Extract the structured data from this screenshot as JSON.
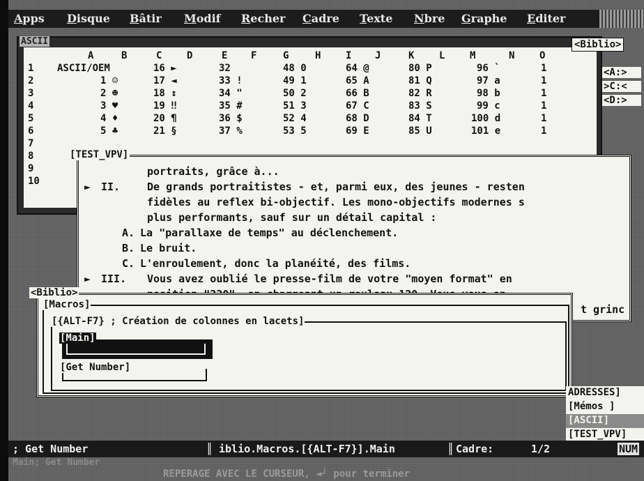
{
  "menu": [
    "Apps",
    "Disque",
    "Bâtir",
    "Modif",
    "Recher",
    "Cadre",
    "Texte",
    "Nbre",
    "Graphe",
    "Editer"
  ],
  "ascii_window": {
    "title": "ASCII",
    "columns": [
      "A",
      "B",
      "C",
      "D",
      "E",
      "F",
      "G",
      "H",
      "I",
      "J",
      "K",
      "L",
      "M",
      "N",
      "O"
    ],
    "rows": [
      "1",
      "2",
      "3",
      "4",
      "5",
      "6",
      "7",
      "8",
      "9",
      "10"
    ],
    "cells": [
      [
        "ASCII/OEM",
        "16 ►",
        "32",
        "48 0",
        "64 @",
        "80 P",
        "96 `",
        "1"
      ],
      [
        "1 ☺",
        "17 ◄",
        "33 !",
        "49 1",
        "65 A",
        "81 Q",
        "97 a",
        "1"
      ],
      [
        "2 ☻",
        "18 ↕",
        "34 \"",
        "50 2",
        "66 B",
        "82 R",
        "98 b",
        "1"
      ],
      [
        "3 ♥",
        "19 ‼",
        "35 #",
        "51 3",
        "67 C",
        "83 S",
        "99 c",
        "1"
      ],
      [
        "4 ♦",
        "20 ¶",
        "36 $",
        "52 4",
        "68 D",
        "84 T",
        "100 d",
        "1"
      ],
      [
        "5 ♣",
        "21 §",
        "37 %",
        "53 5",
        "69 E",
        "85 U",
        "101 e",
        "1"
      ]
    ]
  },
  "right_side": {
    "biblio_label": "<Biblio>",
    "drives": [
      "<A:>",
      ">C:<",
      "<D:>"
    ]
  },
  "doc_window": {
    "title": "[TEST_VPV]",
    "lines": [
      {
        "marker": "",
        "num": "",
        "text": "portraits, grâce à..."
      },
      {
        "marker": "►",
        "num": "II.",
        "text": "De grands portraitistes - et, parmi eux, des jeunes - resten"
      },
      {
        "marker": "",
        "num": "",
        "text": "fidèles au reflex bi-objectif. Les mono-objectifs modernes s"
      },
      {
        "marker": "",
        "num": "",
        "text": "plus performants, sauf sur un détail capital :"
      },
      {
        "marker": "",
        "num": "A.",
        "text": "La \"parallaxe de temps\" au déclenchement."
      },
      {
        "marker": "",
        "num": "B.",
        "text": "Le bruit."
      },
      {
        "marker": "",
        "num": "C.",
        "text": "L'enroulement, donc la planéité, des films."
      },
      {
        "marker": "►",
        "num": "III.",
        "text": "Vous avez oublié le presse-film de votre \"moyen format\" en"
      },
      {
        "marker": "",
        "num": "",
        "text": "position \"220\", en chargeant un rouleau 120. Vous vous en"
      },
      {
        "marker": "",
        "num": "",
        "text": "t grinc"
      }
    ]
  },
  "biblio_window": {
    "title": "<Biblio>",
    "macros_label": "[Macros]",
    "alt_label": "[{ALT-F7} ; Création de colonnes en lacets]",
    "main_label": "[Main]",
    "get_number_label": "[Get Number]"
  },
  "panel_list": [
    "ADRESSES]",
    "[Mémos ]",
    "[ASCII]",
    "[TEST_VPV]"
  ],
  "status_bar": {
    "left": "; Get Number",
    "path": "iblio.Macros.[{ALT-F7}].Main",
    "cadre_label": "Cadre:",
    "cadre_value": "1/2",
    "num": "NUM"
  },
  "hint_line": "Main; Get Number",
  "bottom_hint": "REPERAGE AVEC LE CURSEUR, ◄┘ pour terminer",
  "colors": {
    "background": "#5e5e5e",
    "window": "#f3f3ef",
    "bar": "#1a1a1a"
  }
}
